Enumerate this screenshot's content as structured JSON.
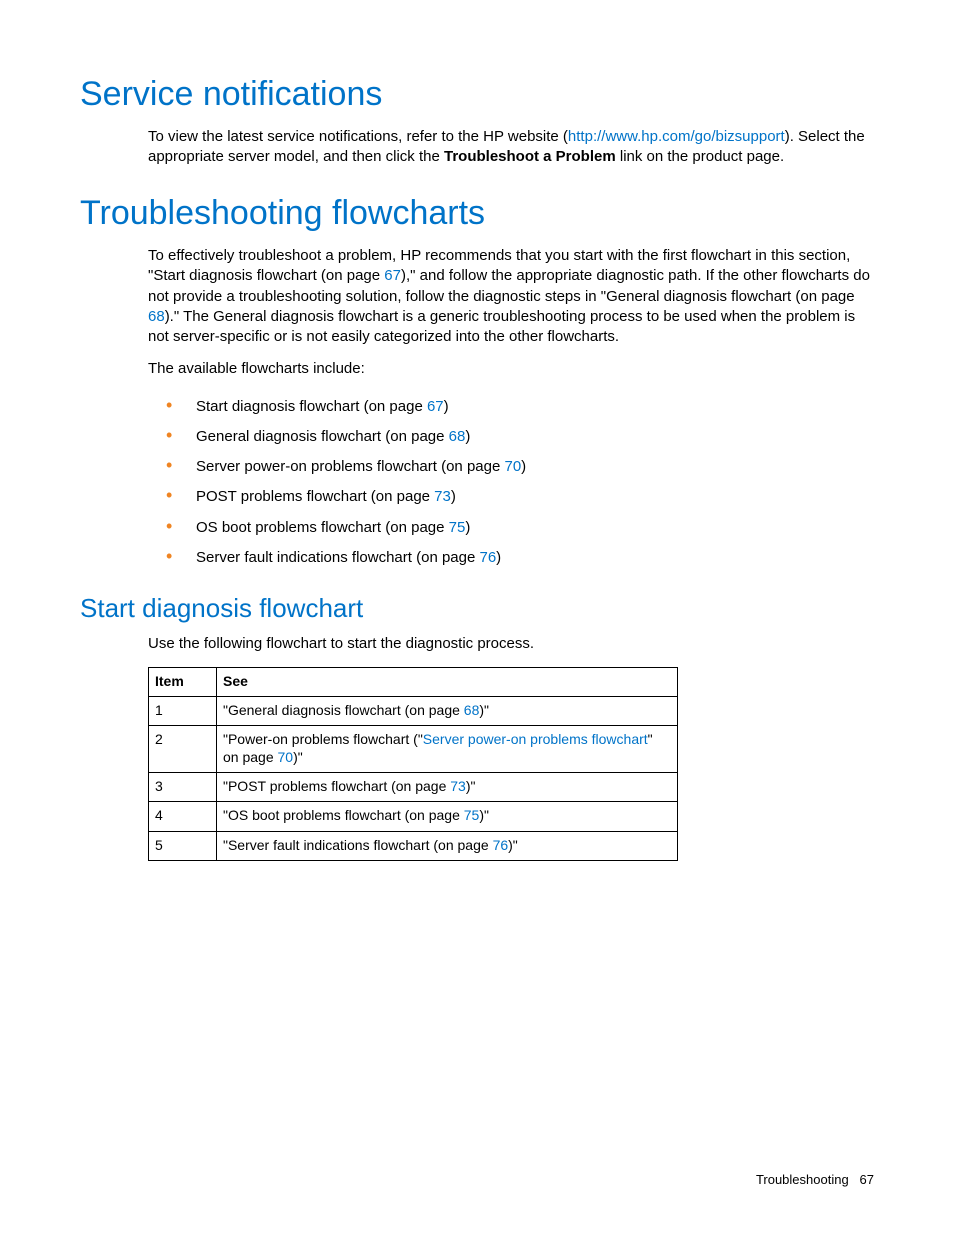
{
  "h1_service": "Service notifications",
  "p_service_1a": "To view the latest service notifications, refer to the HP website (",
  "p_service_link": "http://www.hp.com/go/bizsupport",
  "p_service_1b": "). Select the appropriate server model, and then click the ",
  "p_service_bold": "Troubleshoot a Problem",
  "p_service_1c": " link on the product page.",
  "h1_trouble": "Troubleshooting flowcharts",
  "p_trouble_1a": "To effectively troubleshoot a problem, HP recommends that you start with the first flowchart in this section, \"Start diagnosis flowchart (on page ",
  "p_trouble_1_pg1": "67",
  "p_trouble_1b": "),\" and follow the appropriate diagnostic path. If the other flowcharts do not provide a troubleshooting solution, follow the diagnostic steps in \"General diagnosis flowchart (on page ",
  "p_trouble_1_pg2": "68",
  "p_trouble_1c": ").\" The General diagnosis flowchart is a generic troubleshooting process to be used when the problem is not server-specific or is not easily categorized into the other flowcharts.",
  "p_trouble_2": "The available flowcharts include:",
  "list": [
    {
      "pre": "Start diagnosis flowchart (on page ",
      "pg": "67",
      "post": ")"
    },
    {
      "pre": "General diagnosis flowchart (on page ",
      "pg": "68",
      "post": ")"
    },
    {
      "pre": "Server power-on problems flowchart (on page ",
      "pg": "70",
      "post": ")"
    },
    {
      "pre": "POST problems flowchart (on page ",
      "pg": "73",
      "post": ")"
    },
    {
      "pre": "OS boot problems flowchart (on page ",
      "pg": "75",
      "post": ")"
    },
    {
      "pre": "Server fault indications flowchart (on page ",
      "pg": "76",
      "post": ")"
    }
  ],
  "h2_start": "Start diagnosis flowchart",
  "p_start": "Use the following flowchart to start the diagnostic process.",
  "tbl": {
    "h_item": "Item",
    "h_see": "See",
    "rows": [
      {
        "n": "1",
        "a": "\"General diagnosis flowchart (on page ",
        "l1": "68",
        "b": ")\"",
        "l2": "",
        "c": ""
      },
      {
        "n": "2",
        "a": "\"Power-on problems flowchart (\"",
        "l1": "Server power-on problems flowchart",
        "b": "\" on page ",
        "l2": "70",
        "c": ")\""
      },
      {
        "n": "3",
        "a": "\"POST problems flowchart (on page ",
        "l1": "73",
        "b": ")\"",
        "l2": "",
        "c": ""
      },
      {
        "n": "4",
        "a": "\"OS boot problems flowchart (on page ",
        "l1": "75",
        "b": ")\"",
        "l2": "",
        "c": ""
      },
      {
        "n": "5",
        "a": "\"Server fault indications flowchart (on page ",
        "l1": "76",
        "b": ")\"",
        "l2": "",
        "c": ""
      }
    ]
  },
  "footer_section": "Troubleshooting",
  "footer_page": "67"
}
